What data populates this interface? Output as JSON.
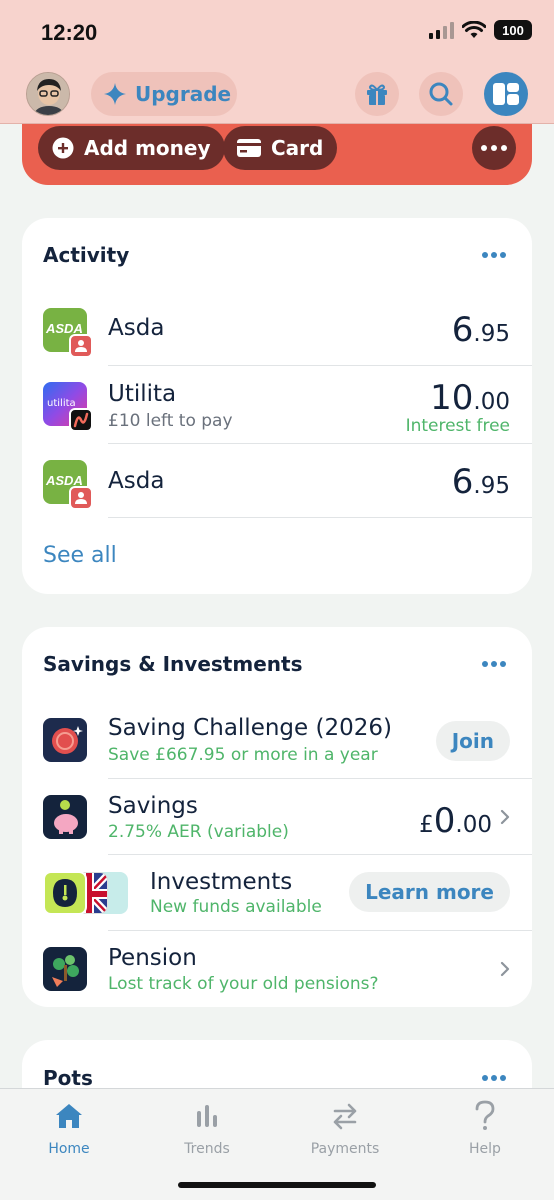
{
  "status": {
    "time": "12:20",
    "battery": "100"
  },
  "header": {
    "upgrade_label": "Upgrade",
    "icons": [
      "gift-icon",
      "search-icon",
      "dashboard-icon"
    ]
  },
  "account": {
    "add_money_label": "Add money",
    "card_label": "Card"
  },
  "activity": {
    "title": "Activity",
    "see_all": "See all",
    "items": [
      {
        "merchant": "Asda",
        "logo_text": "ASDA",
        "subtitle": "",
        "amount_whole": "6",
        "amount_frac": ".95",
        "note": ""
      },
      {
        "merchant": "Utilita",
        "logo_text": "utilita",
        "subtitle": "£10 left to pay",
        "amount_whole": "10",
        "amount_frac": ".00",
        "note": "Interest free"
      },
      {
        "merchant": "Asda",
        "logo_text": "ASDA",
        "subtitle": "",
        "amount_whole": "6",
        "amount_frac": ".95",
        "note": ""
      }
    ]
  },
  "savings": {
    "title": "Savings & Investments",
    "items": [
      {
        "title": "Saving Challenge (2026)",
        "subtitle": "Save £667.95 or more in a year",
        "action": "Join"
      },
      {
        "title": "Savings",
        "subtitle": "2.75% AER (variable)",
        "currency": "£",
        "amount_whole": "0",
        "amount_frac": ".00"
      },
      {
        "title": "Investments",
        "subtitle": "New funds available",
        "action": "Learn more"
      },
      {
        "title": "Pension",
        "subtitle": "Lost track of your old pensions?"
      }
    ]
  },
  "pots": {
    "title": "Pots"
  },
  "nav": {
    "tabs": [
      {
        "label": "Home",
        "icon": "home-icon",
        "active": true
      },
      {
        "label": "Trends",
        "icon": "trends-icon",
        "active": false
      },
      {
        "label": "Payments",
        "icon": "payments-icon",
        "active": false
      },
      {
        "label": "Help",
        "icon": "help-icon",
        "active": false
      }
    ]
  },
  "colors": {
    "accent": "#3c86bf",
    "card_red": "#ea604f",
    "positive_green": "#4fb56a",
    "asda_green": "#78b243"
  }
}
